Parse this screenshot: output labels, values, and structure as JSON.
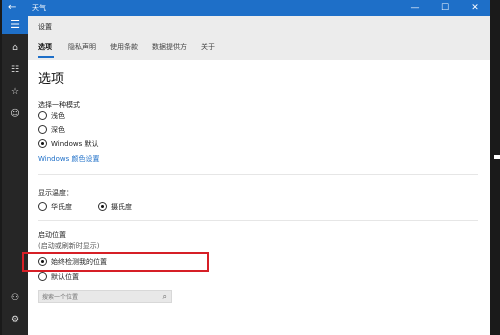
{
  "window": {
    "title": "天气",
    "back_glyph": "←",
    "controls": {
      "minimize": "—",
      "maximize": "☐",
      "close": "✕"
    }
  },
  "sidebar": {
    "items": [
      {
        "icon": "hamburger-menu-icon",
        "glyph": "☰"
      },
      {
        "icon": "home-icon",
        "glyph": "⌂"
      },
      {
        "icon": "list-icon",
        "glyph": "☷"
      },
      {
        "icon": "star-icon",
        "glyph": "☆"
      },
      {
        "icon": "smile-icon",
        "glyph": "☺"
      },
      {
        "icon": "user-icon",
        "glyph": "⚇"
      },
      {
        "icon": "gear-icon",
        "glyph": "⚙"
      }
    ]
  },
  "header": {
    "title": "设置",
    "tabs": [
      {
        "label": "选项",
        "active": true
      },
      {
        "label": "隐私声明",
        "active": false
      },
      {
        "label": "使用条款",
        "active": false
      },
      {
        "label": "数据提供方",
        "active": false
      },
      {
        "label": "关于",
        "active": false
      }
    ]
  },
  "main": {
    "page_title": "选项",
    "mode_section": {
      "label": "选择一种模式",
      "options": [
        {
          "label": "浅色",
          "checked": false
        },
        {
          "label": "深色",
          "checked": false
        },
        {
          "label": "Windows 默认",
          "checked": true
        }
      ],
      "link": "Windows 颜色设置"
    },
    "temp_section": {
      "label": "显示温度：",
      "options": [
        {
          "label": "华氏度",
          "checked": false
        },
        {
          "label": "摄氏度",
          "checked": true
        }
      ]
    },
    "launch_section": {
      "label": "启动位置",
      "sublabel": "(启动或刷新时显示)",
      "options": [
        {
          "label": "始终检测我的位置",
          "checked": true
        },
        {
          "label": "默认位置",
          "checked": false
        }
      ],
      "search_placeholder": "搜索一个位置"
    }
  },
  "colors": {
    "accent": "#1e6fc8",
    "highlight": "#d61f26",
    "sidebar": "#262626"
  }
}
